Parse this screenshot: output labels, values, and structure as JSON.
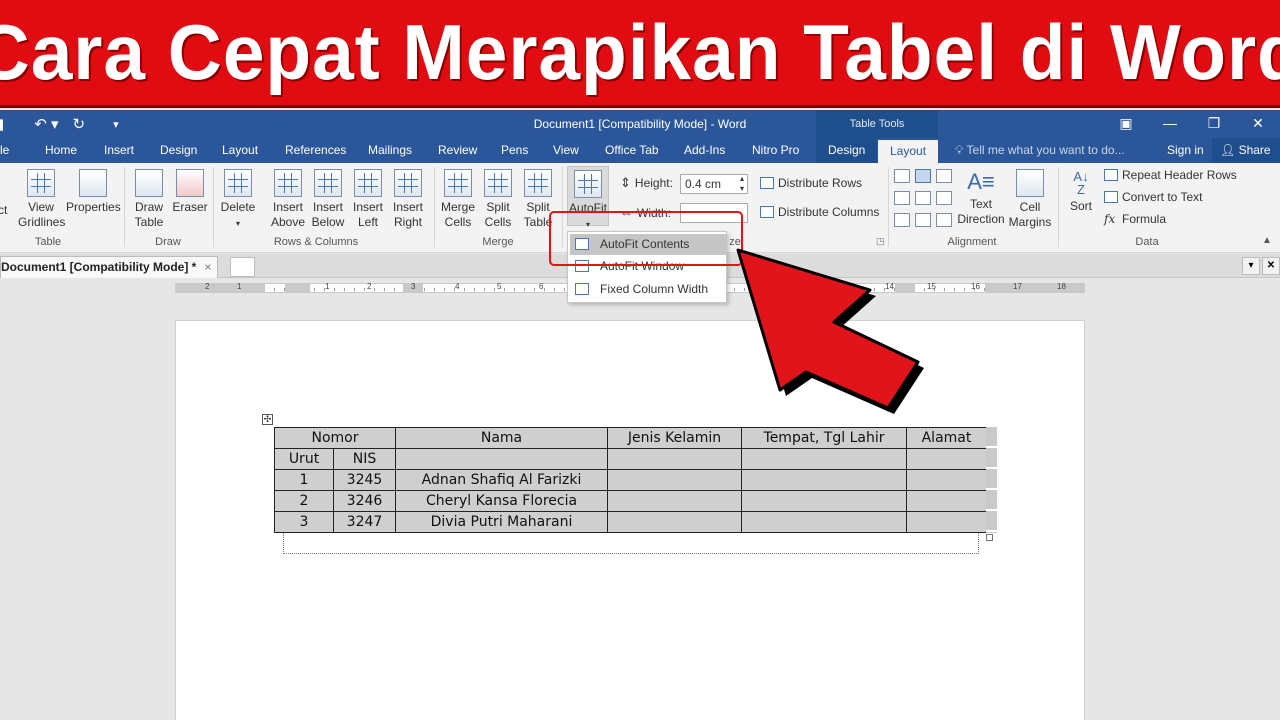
{
  "banner": {
    "title": "Cara Cepat Merapikan Tabel di Word"
  },
  "titlebar": {
    "document_title": "Document1 [Compatibility Mode] - Word",
    "context_group": "Table Tools"
  },
  "tabs": {
    "file": "le",
    "home": "Home",
    "insert": "Insert",
    "design": "Design",
    "layout": "Layout",
    "references": "References",
    "mailings": "Mailings",
    "review": "Review",
    "pens": "Pens",
    "view": "View",
    "office_tab": "Office Tab",
    "addins": "Add-Ins",
    "nitro": "Nitro Pro",
    "table_design": "Design",
    "table_layout": "Layout",
    "tell_me": "Tell me what you want to do...",
    "sign_in": "Sign in",
    "share": "Share"
  },
  "ribbon": {
    "select": "ct",
    "view_gridlines_1": "View",
    "view_gridlines_2": "Gridlines",
    "properties": "Properties",
    "group_table": "Table",
    "draw_table_1": "Draw",
    "draw_table_2": "Table",
    "eraser": "Eraser",
    "group_draw": "Draw",
    "delete": "Delete",
    "insert_above_1": "Insert",
    "insert_above_2": "Above",
    "insert_below_1": "Insert",
    "insert_below_2": "Below",
    "insert_left_1": "Insert",
    "insert_left_2": "Left",
    "insert_right_1": "Insert",
    "insert_right_2": "Right",
    "group_rows_columns": "Rows & Columns",
    "merge_cells_1": "Merge",
    "merge_cells_2": "Cells",
    "split_cells_1": "Split",
    "split_cells_2": "Cells",
    "split_table_1": "Split",
    "split_table_2": "Table",
    "group_merge": "Merge",
    "autofit": "AutoFit",
    "height_label": "Height:",
    "height_value": "0.4 cm",
    "width_label": "Width:",
    "distribute_rows": "Distribute Rows",
    "distribute_columns": "Distribute Columns",
    "group_cell_size_tail": "ze",
    "text_direction_1": "Text",
    "text_direction_2": "Direction",
    "cell_margins_1": "Cell",
    "cell_margins_2": "Margins",
    "group_alignment": "Alignment",
    "sort": "Sort",
    "repeat_header_rows": "Repeat Header Rows",
    "convert_to_text": "Convert to Text",
    "formula": "Formula",
    "group_data": "Data"
  },
  "autofit_menu": {
    "items": [
      "AutoFit Contents",
      "AutoFit Window",
      "Fixed Column Width"
    ]
  },
  "doc_tabs": {
    "active": "Document1 [Compatibility Mode] *",
    "close": "×"
  },
  "ruler": {
    "numbers": [
      "2",
      "1",
      "1",
      "2",
      "3",
      "4",
      "5",
      "6",
      "14",
      "15",
      "16",
      "17",
      "18"
    ]
  },
  "table": {
    "header1": [
      "Nomor",
      "Nama",
      "Jenis Kelamin",
      "Tempat, Tgl Lahir",
      "Alamat"
    ],
    "header2": [
      "Urut",
      "NIS"
    ],
    "rows": [
      [
        "1",
        "3245",
        "Adnan Shafiq Al Farizki"
      ],
      [
        "2",
        "3246",
        "Cheryl Kansa Florecia"
      ],
      [
        "3",
        "3247",
        "Divia Putri Maharani"
      ]
    ]
  },
  "colors": {
    "banner_red": "#e10b12",
    "word_blue": "#2b579a",
    "arrow_red": "#e0141a"
  }
}
